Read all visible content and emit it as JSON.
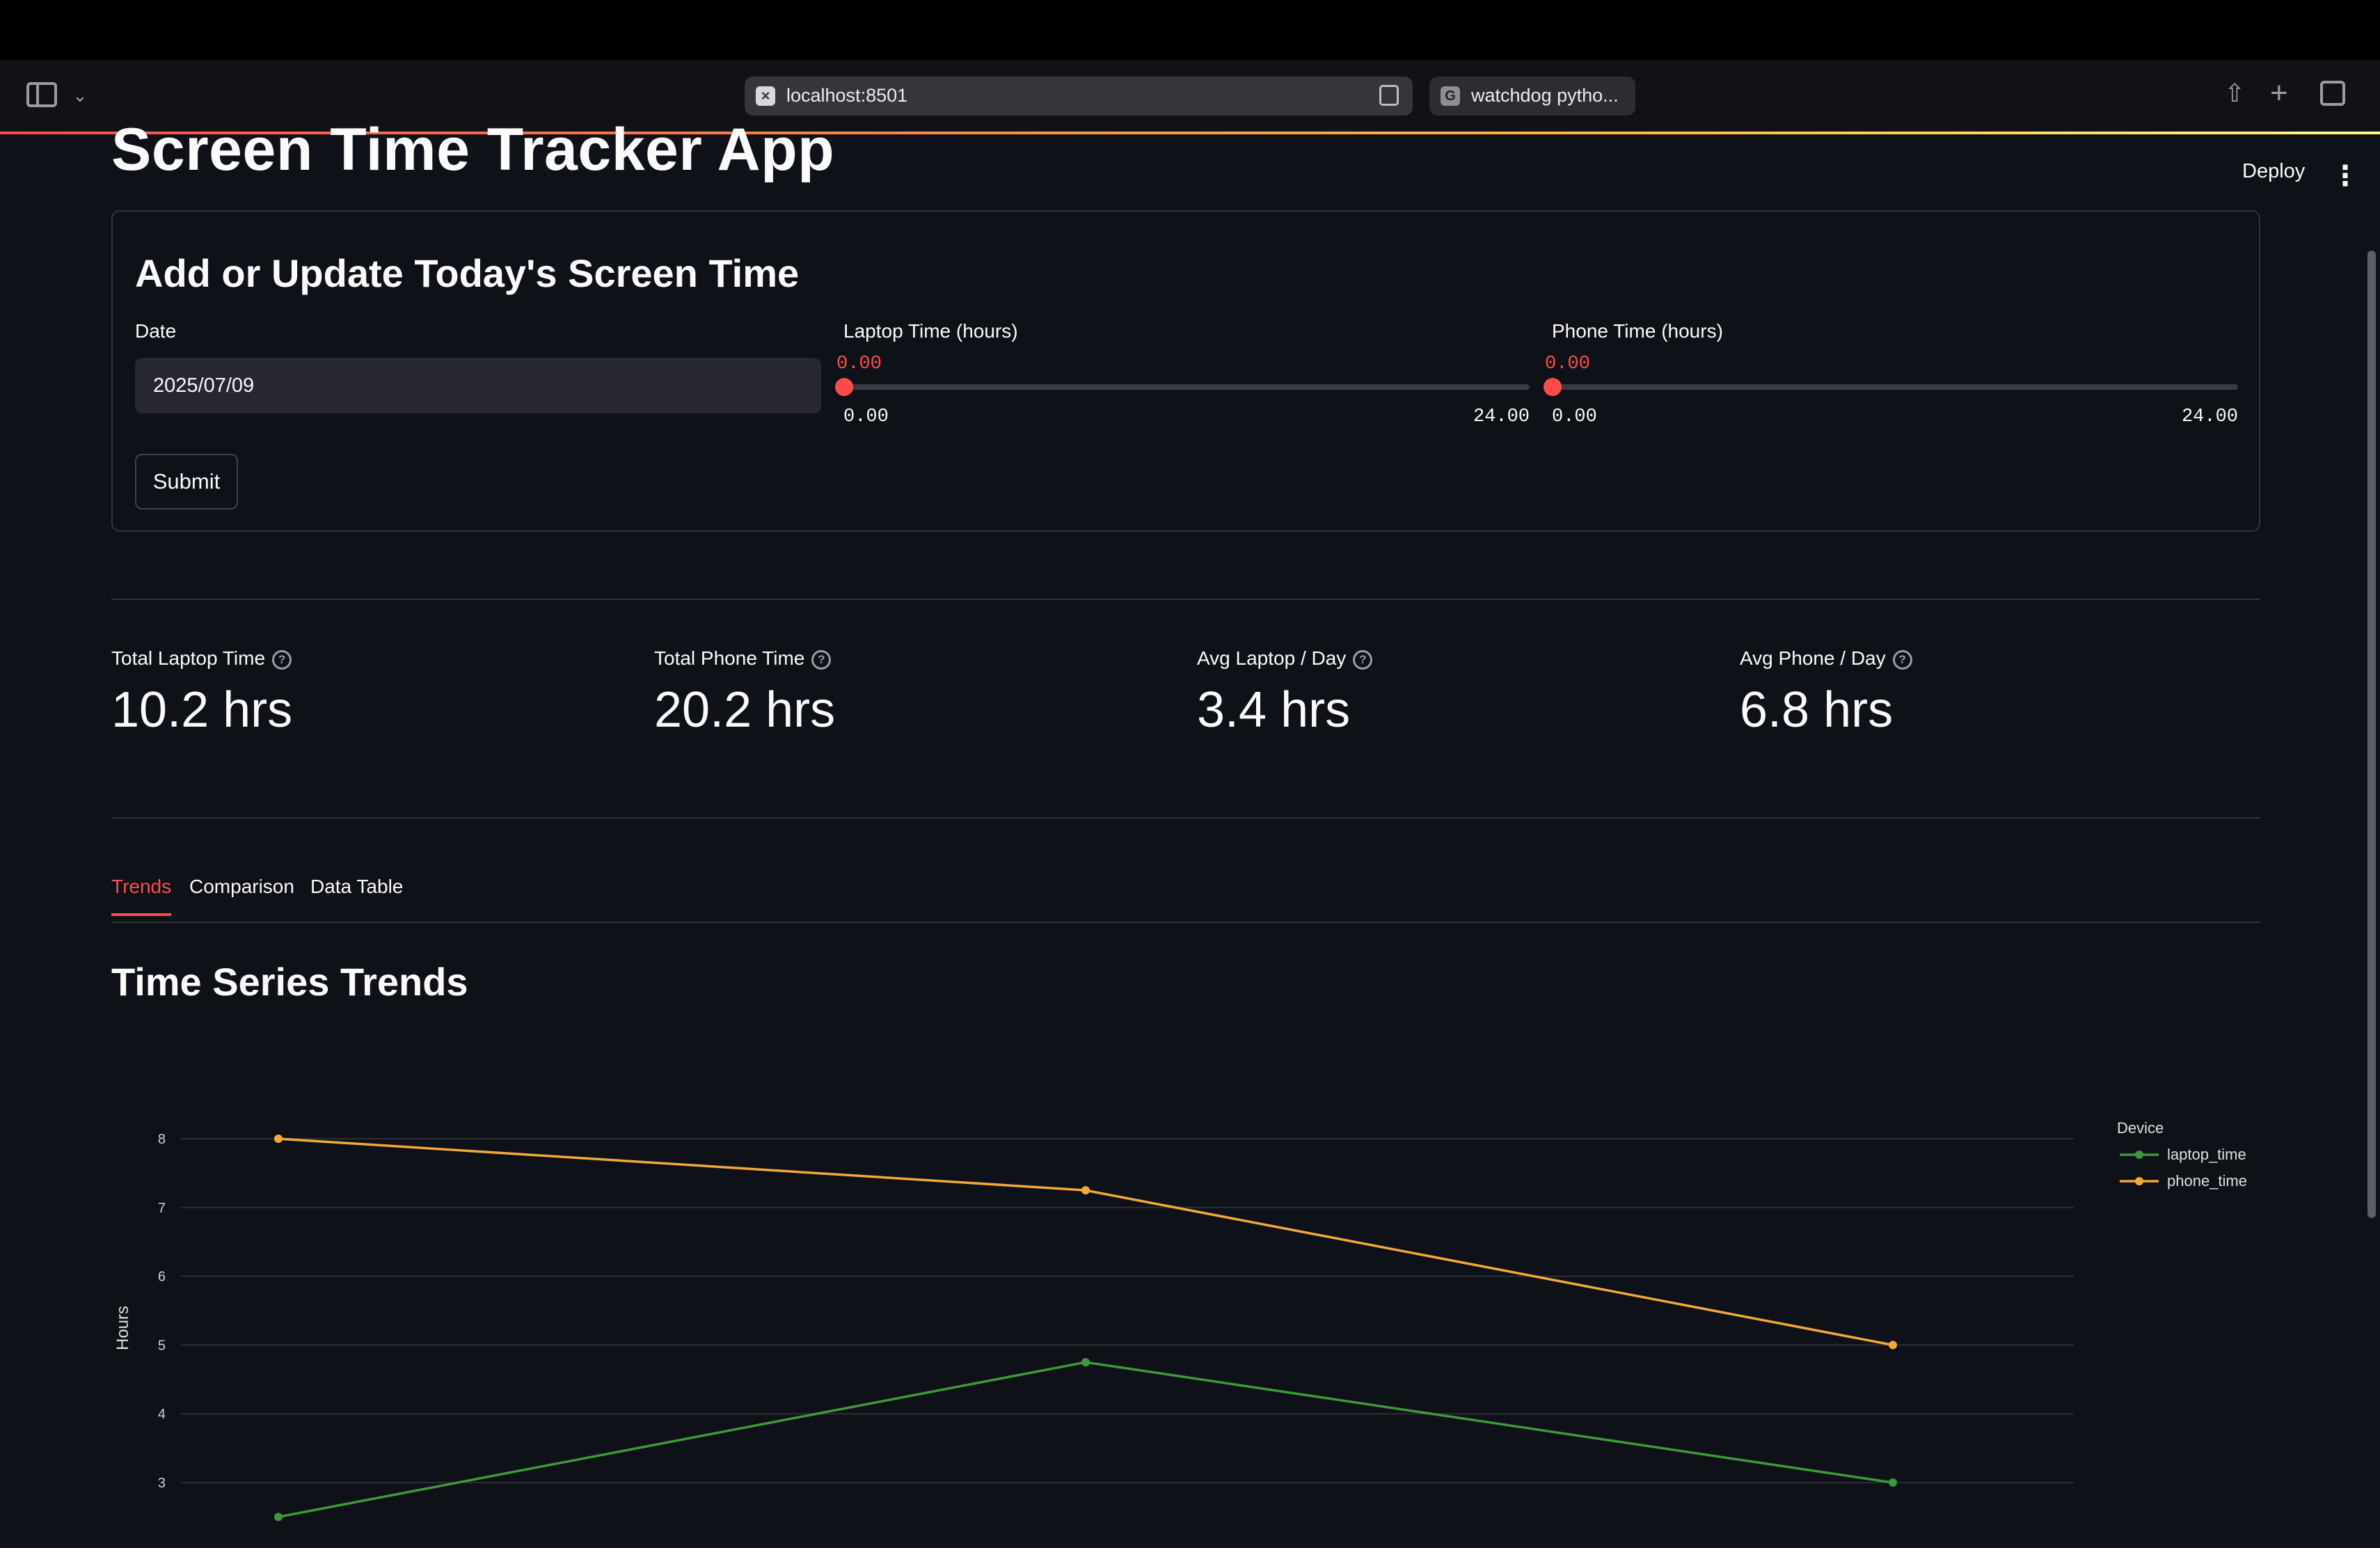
{
  "browser": {
    "url": "localhost:8501",
    "url_favicon": "×",
    "second_tab": "watchdog pytho...",
    "second_tab_favicon": "G"
  },
  "app": {
    "title": "Screen Time Tracker App",
    "deploy_label": "Deploy",
    "menu_icon": "⋮"
  },
  "form": {
    "title": "Add or Update Today's Screen Time",
    "date_label": "Date",
    "date_value": "2025/07/09",
    "laptop": {
      "label": "Laptop Time (hours)",
      "value": "0.00",
      "min": "0.00",
      "max": "24.00"
    },
    "phone": {
      "label": "Phone Time (hours)",
      "value": "0.00",
      "min": "0.00",
      "max": "24.00"
    },
    "submit_label": "Submit"
  },
  "metrics": [
    {
      "label": "Total Laptop Time",
      "value": "10.2 hrs"
    },
    {
      "label": "Total Phone Time",
      "value": "20.2 hrs"
    },
    {
      "label": "Avg Laptop / Day",
      "value": "3.4 hrs"
    },
    {
      "label": "Avg Phone / Day",
      "value": "6.8 hrs"
    }
  ],
  "help_glyph": "?",
  "tabs": [
    "Trends",
    "Comparison",
    "Data Table"
  ],
  "section_title": "Time Series Trends",
  "chart_data": {
    "type": "line",
    "ylabel": "Hours",
    "yticks": [
      3,
      4,
      5,
      6,
      7,
      8
    ],
    "ylim": [
      2.3,
      8.9
    ],
    "x": [
      0,
      1,
      2
    ],
    "grid": true,
    "legend_title": "Device",
    "legend_position": "right",
    "series": [
      {
        "name": "laptop_time",
        "values": [
          2.5,
          4.75,
          3.0
        ],
        "color": "#3d9a3a"
      },
      {
        "name": "phone_time",
        "values": [
          8.0,
          7.25,
          5.0
        ],
        "color": "#f5a83a"
      }
    ]
  }
}
